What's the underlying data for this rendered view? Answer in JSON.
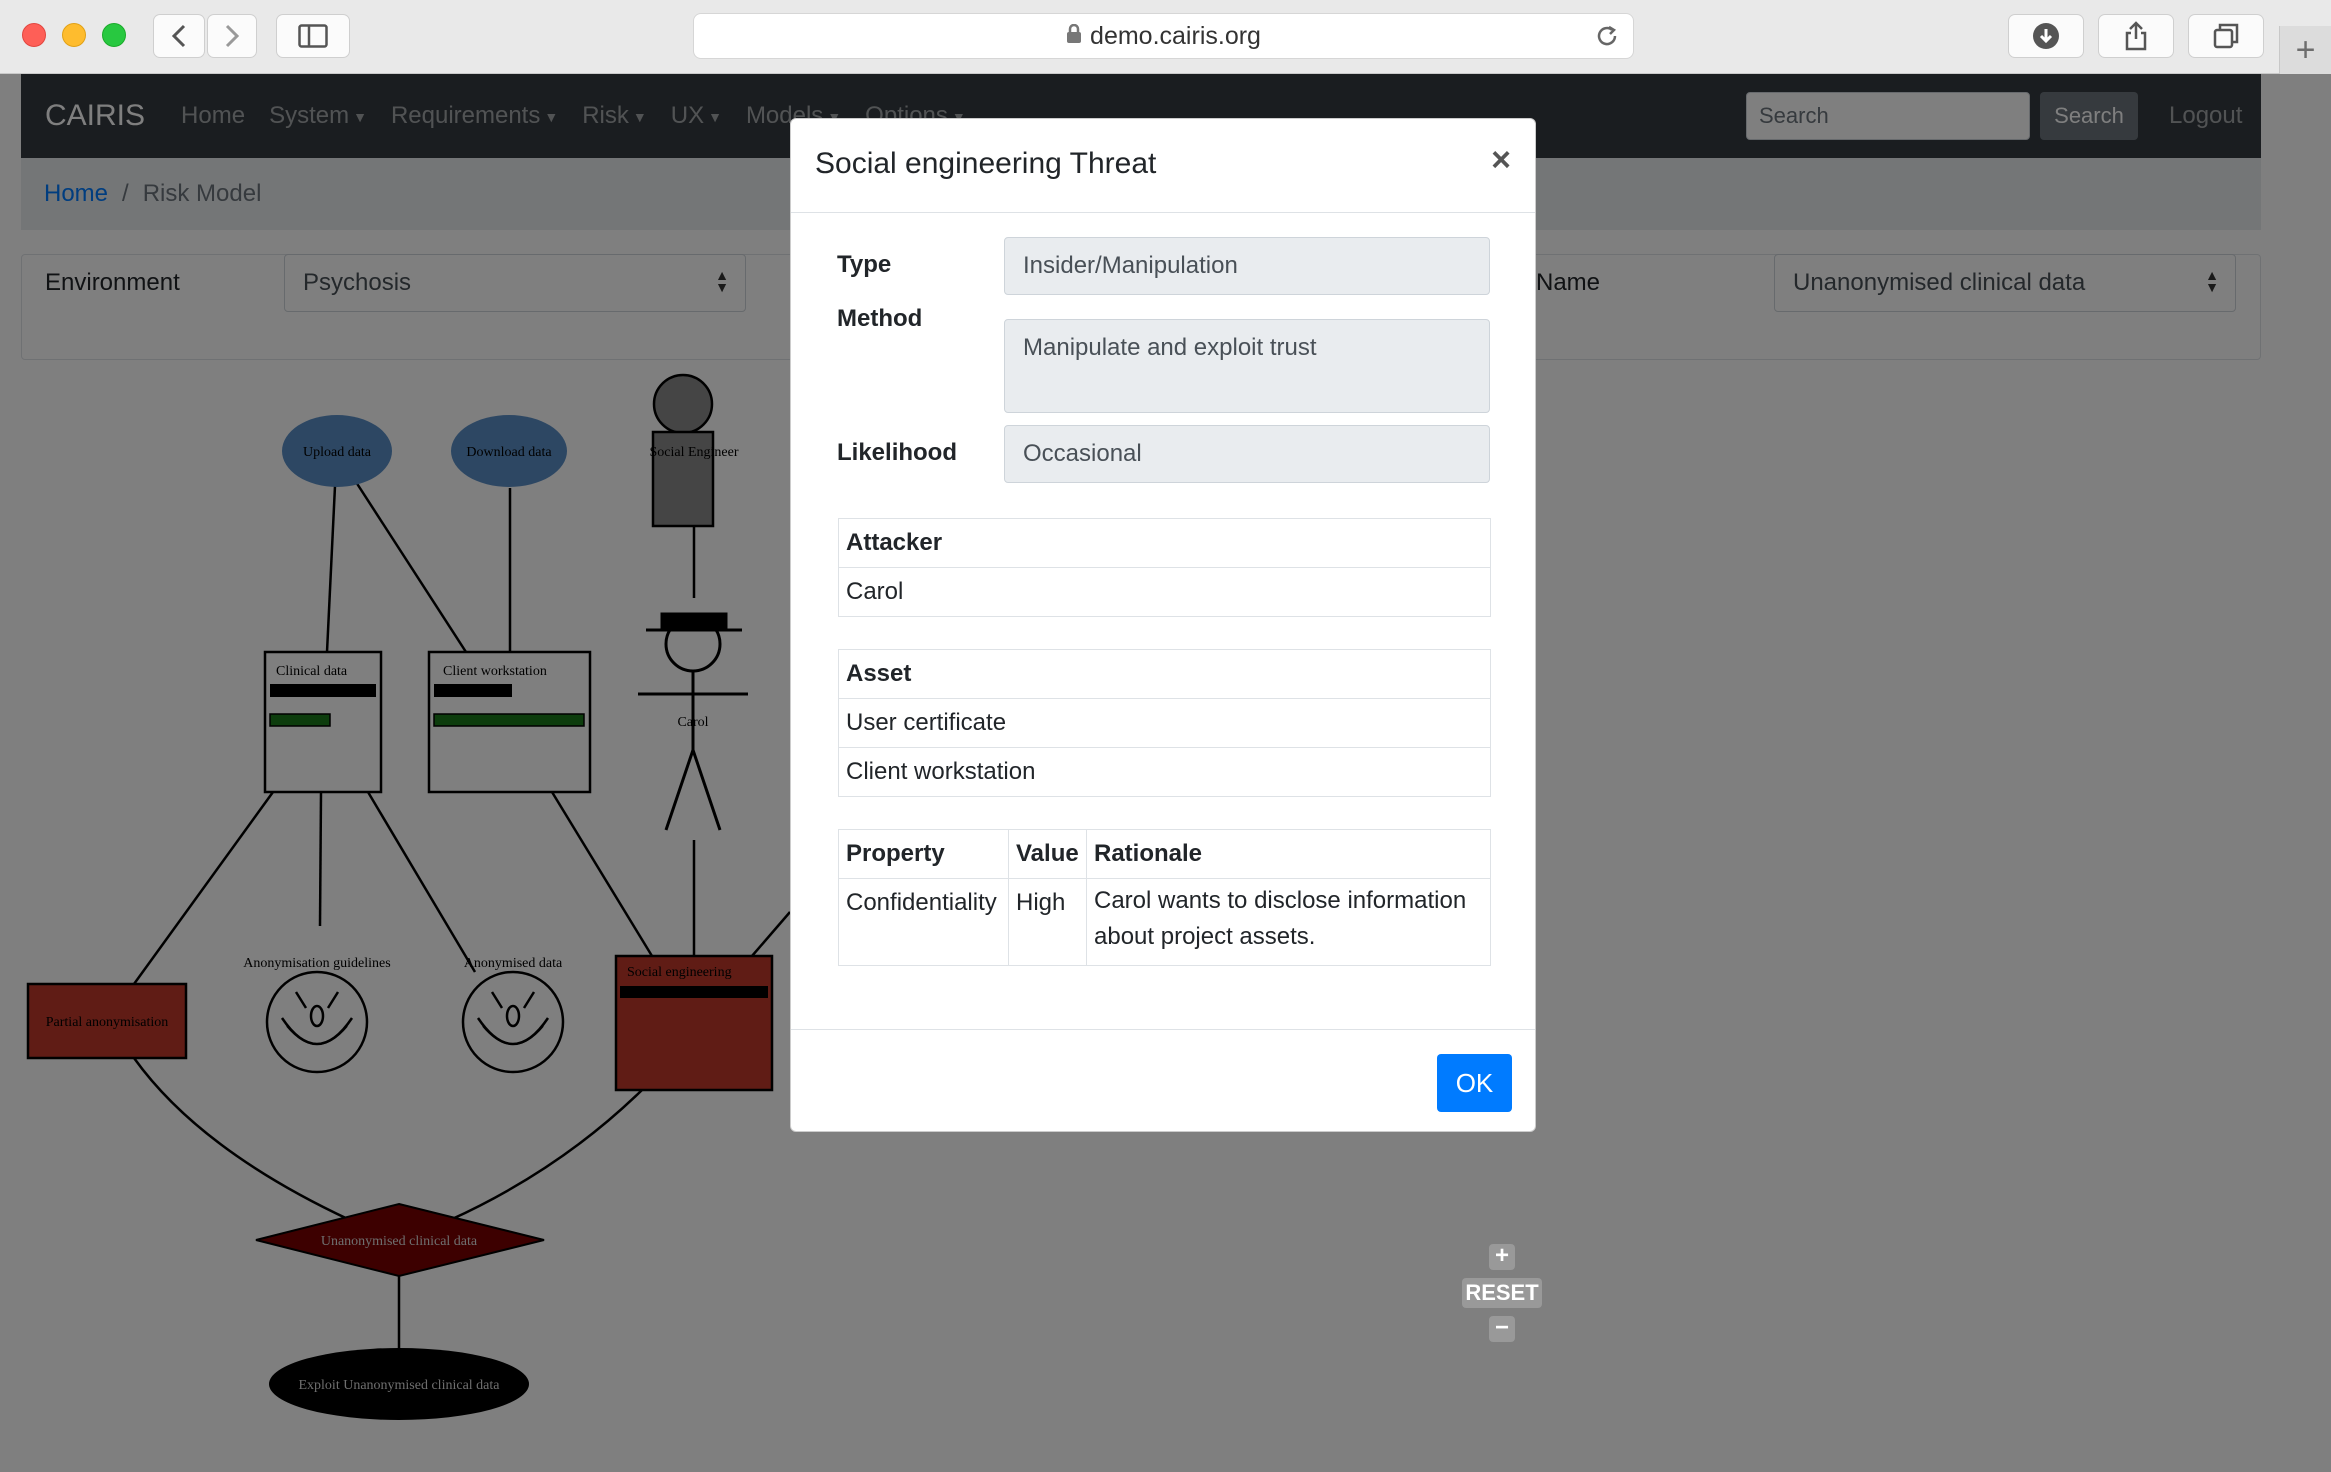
{
  "browser": {
    "url": "demo.cairis.org"
  },
  "navbar": {
    "brand": "CAIRIS",
    "items": [
      {
        "label": "Home",
        "has_dropdown": false
      },
      {
        "label": "System",
        "has_dropdown": true
      },
      {
        "label": "Requirements",
        "has_dropdown": true
      },
      {
        "label": "Risk",
        "has_dropdown": true
      },
      {
        "label": "UX",
        "has_dropdown": true
      },
      {
        "label": "Models",
        "has_dropdown": true
      },
      {
        "label": "Options",
        "has_dropdown": true
      }
    ],
    "search_placeholder": "Search",
    "search_button": "Search",
    "logout": "Logout"
  },
  "breadcrumb": {
    "home": "Home",
    "current": "Risk Model"
  },
  "filters": {
    "environment_label": "Environment",
    "environment_value": "Psychosis",
    "name_label": "Name",
    "name_value": "Unanonymised clinical data"
  },
  "diagram": {
    "use_cases": [
      "Upload data",
      "Download data"
    ],
    "roles": [
      "Social Engineer"
    ],
    "assets": [
      "Clinical data",
      "Client workstation"
    ],
    "attackers": [
      "Carol"
    ],
    "goals": [
      "Anonymisation guidelines",
      "Anonymised data"
    ],
    "responses": [
      "Partial anonymisation"
    ],
    "threats": [
      "Social engineering"
    ],
    "risk": "Unanonymised clinical data",
    "misuse_case": "Exploit Unanonymised clinical data",
    "colors": {
      "use_case": "#5a8fc7",
      "response": "#c0392b",
      "threat": "#c0392b",
      "risk": "#7a0000",
      "misuse_case": "#000000"
    }
  },
  "zoom": {
    "plus": "+",
    "reset": "RESET",
    "minus": "−"
  },
  "modal": {
    "title": "Social engineering Threat",
    "close": "×",
    "type_label": "Type",
    "type_value": "Insider/Manipulation",
    "method_label": "Method",
    "method_value": "Manipulate and exploit trust",
    "likelihood_label": "Likelihood",
    "likelihood_value": "Occasional",
    "attacker_header": "Attacker",
    "attackers": [
      "Carol"
    ],
    "asset_header": "Asset",
    "assets": [
      "User certificate",
      "Client workstation"
    ],
    "property_headers": {
      "property": "Property",
      "value": "Value",
      "rationale": "Rationale"
    },
    "properties": [
      {
        "property": "Confidentiality",
        "value": "High",
        "rationale": "Carol wants to disclose information about project assets."
      }
    ],
    "ok": "OK"
  }
}
